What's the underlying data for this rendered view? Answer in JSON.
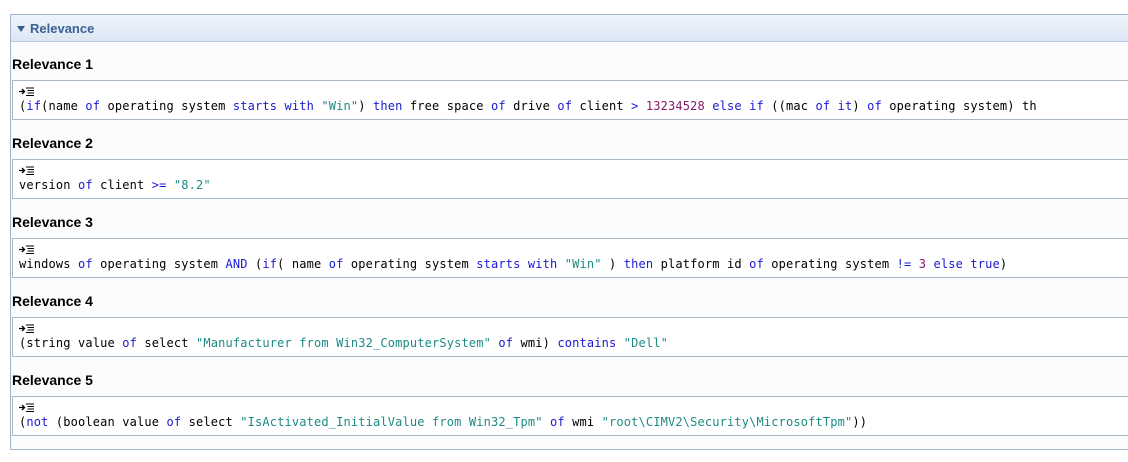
{
  "panel": {
    "title": "Relevance"
  },
  "sections": [
    {
      "title": "Relevance 1",
      "tokens": [
        {
          "t": "(",
          "c": "txt"
        },
        {
          "t": "if",
          "c": "kw"
        },
        {
          "t": "(name ",
          "c": "txt"
        },
        {
          "t": "of",
          "c": "kw"
        },
        {
          "t": " operating system ",
          "c": "txt"
        },
        {
          "t": "starts with",
          "c": "kw"
        },
        {
          "t": " ",
          "c": "txt"
        },
        {
          "t": "\"Win\"",
          "c": "str"
        },
        {
          "t": ") ",
          "c": "txt"
        },
        {
          "t": "then",
          "c": "kw"
        },
        {
          "t": " free space ",
          "c": "txt"
        },
        {
          "t": "of",
          "c": "kw"
        },
        {
          "t": " drive ",
          "c": "txt"
        },
        {
          "t": "of",
          "c": "kw"
        },
        {
          "t": " client ",
          "c": "txt"
        },
        {
          "t": ">",
          "c": "op"
        },
        {
          "t": " ",
          "c": "txt"
        },
        {
          "t": "13234528",
          "c": "num"
        },
        {
          "t": " ",
          "c": "txt"
        },
        {
          "t": "else",
          "c": "kw"
        },
        {
          "t": " ",
          "c": "txt"
        },
        {
          "t": "if",
          "c": "kw"
        },
        {
          "t": " ((mac ",
          "c": "txt"
        },
        {
          "t": "of",
          "c": "kw"
        },
        {
          "t": " ",
          "c": "txt"
        },
        {
          "t": "it",
          "c": "kw"
        },
        {
          "t": ") ",
          "c": "txt"
        },
        {
          "t": "of",
          "c": "kw"
        },
        {
          "t": " operating system) th",
          "c": "txt"
        }
      ]
    },
    {
      "title": "Relevance 2",
      "tokens": [
        {
          "t": "version ",
          "c": "txt"
        },
        {
          "t": "of",
          "c": "kw"
        },
        {
          "t": " client ",
          "c": "txt"
        },
        {
          "t": ">=",
          "c": "op"
        },
        {
          "t": " ",
          "c": "txt"
        },
        {
          "t": "\"8.2\"",
          "c": "str"
        }
      ]
    },
    {
      "title": "Relevance 3",
      "tokens": [
        {
          "t": "windows ",
          "c": "txt"
        },
        {
          "t": "of",
          "c": "kw"
        },
        {
          "t": " operating system ",
          "c": "txt"
        },
        {
          "t": "AND",
          "c": "kw"
        },
        {
          "t": " (",
          "c": "txt"
        },
        {
          "t": "if",
          "c": "kw"
        },
        {
          "t": "( name ",
          "c": "txt"
        },
        {
          "t": "of",
          "c": "kw"
        },
        {
          "t": " operating system ",
          "c": "txt"
        },
        {
          "t": "starts with",
          "c": "kw"
        },
        {
          "t": " ",
          "c": "txt"
        },
        {
          "t": "\"Win\"",
          "c": "str"
        },
        {
          "t": " ) ",
          "c": "txt"
        },
        {
          "t": "then",
          "c": "kw"
        },
        {
          "t": " platform id ",
          "c": "txt"
        },
        {
          "t": "of",
          "c": "kw"
        },
        {
          "t": " operating system ",
          "c": "txt"
        },
        {
          "t": "!=",
          "c": "op"
        },
        {
          "t": " ",
          "c": "txt"
        },
        {
          "t": "3",
          "c": "num"
        },
        {
          "t": " ",
          "c": "txt"
        },
        {
          "t": "else",
          "c": "kw"
        },
        {
          "t": " ",
          "c": "txt"
        },
        {
          "t": "true",
          "c": "kw"
        },
        {
          "t": ")",
          "c": "txt"
        }
      ]
    },
    {
      "title": "Relevance 4",
      "tokens": [
        {
          "t": "(string value ",
          "c": "txt"
        },
        {
          "t": "of",
          "c": "kw"
        },
        {
          "t": " select ",
          "c": "txt"
        },
        {
          "t": "\"Manufacturer from Win32_ComputerSystem\"",
          "c": "str"
        },
        {
          "t": " ",
          "c": "txt"
        },
        {
          "t": "of",
          "c": "kw"
        },
        {
          "t": " wmi) ",
          "c": "txt"
        },
        {
          "t": "contains",
          "c": "kw"
        },
        {
          "t": " ",
          "c": "txt"
        },
        {
          "t": "\"Dell\"",
          "c": "str"
        }
      ]
    },
    {
      "title": "Relevance 5",
      "tokens": [
        {
          "t": "(",
          "c": "txt"
        },
        {
          "t": "not",
          "c": "kw"
        },
        {
          "t": " (boolean value ",
          "c": "txt"
        },
        {
          "t": "of",
          "c": "kw"
        },
        {
          "t": " select ",
          "c": "txt"
        },
        {
          "t": "\"IsActivated_InitialValue from Win32_Tpm\"",
          "c": "str"
        },
        {
          "t": " ",
          "c": "txt"
        },
        {
          "t": "of",
          "c": "kw"
        },
        {
          "t": " wmi ",
          "c": "txt"
        },
        {
          "t": "\"root\\CIMV2\\Security\\MicrosoftTpm\"",
          "c": "str"
        },
        {
          "t": "))",
          "c": "txt"
        }
      ]
    }
  ],
  "icons": {
    "collapse": "triangle-down-icon",
    "format": "format-relevance-icon"
  },
  "colors": {
    "keyword": "#1a1ad4",
    "string": "#1d8a84",
    "number": "#8a1a6a",
    "title": "#3b6293"
  }
}
